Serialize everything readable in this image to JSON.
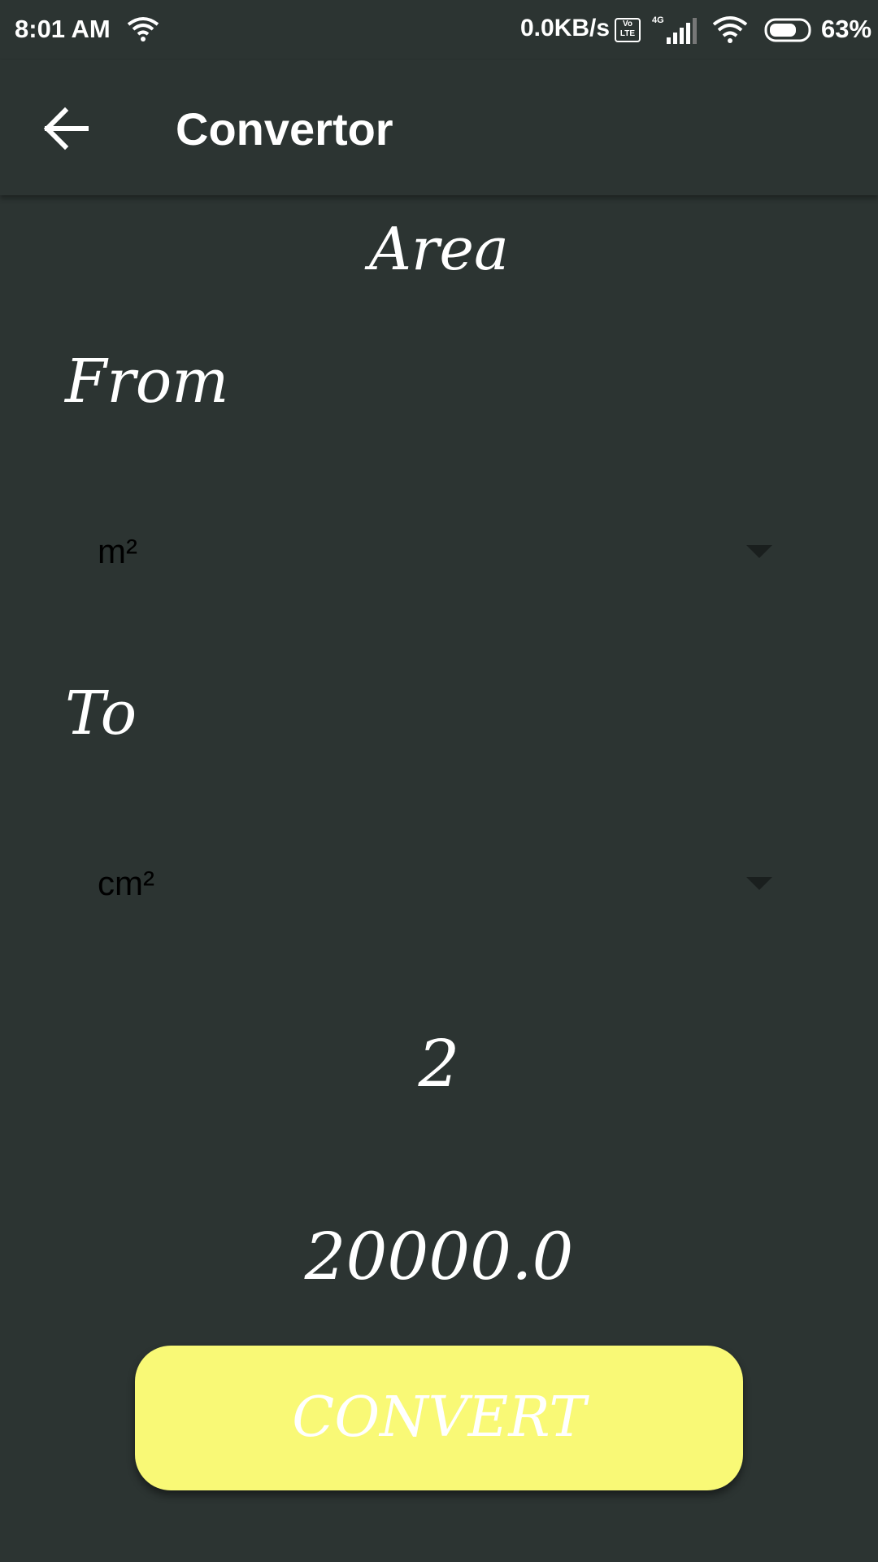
{
  "status_bar": {
    "time": "8:01 AM",
    "net_speed": "0.0KB/s",
    "volte": "Vo LTE",
    "network_type": "4G",
    "battery": "63%",
    "icons": [
      "wifi-icon",
      "volte-icon",
      "signal-icon",
      "wifi-icon",
      "battery-icon"
    ]
  },
  "app_bar": {
    "title": "Convertor",
    "back_icon": "arrow-left-icon"
  },
  "converter": {
    "category": "Area",
    "from_label": "From",
    "from_unit": "m²",
    "to_label": "To",
    "to_unit": "cm²",
    "input_value": "2",
    "result": "20000.0",
    "convert_label": "CONVERT"
  },
  "colors": {
    "background": "#2c3432",
    "button": "#f9f976",
    "text": "#ffffff",
    "spinner_text": "#000000"
  }
}
